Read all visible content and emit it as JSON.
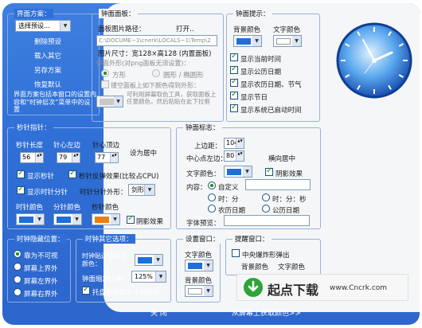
{
  "colors": {
    "app_blue": "#2f6fd6",
    "panel_bg": "#f5f6f8",
    "swatch_blue": "#1e6fd8",
    "swatch_orange": "#f07d10",
    "swatch_gray": "#c8c8c8"
  },
  "left": {
    "scheme_title": "界面方案：",
    "scheme_select": "选择预设...",
    "delete_preset": "删除预设",
    "load_other": "载入其它",
    "save_as": "另存方案",
    "restore_default": "恢复默认",
    "scheme_note": "界面方案包括本窗口的设置内容和“时钟层次”菜单中的设置",
    "second_hand_title": "秒针指针：",
    "hidden_position_title": "时钟隐藏位置：",
    "hidden_options": [
      "靠为不可视",
      "屏幕上界外",
      "屏幕左界外",
      "屏幕右界外"
    ]
  },
  "clock_panel": {
    "title": "钟面面板：",
    "image_path_label": "面板图片路径：",
    "open_label": "打开..",
    "path_value": "C:\\DOCUME~1\\cnerk\\LOCALS~1\\Temp\\2",
    "image_size": "图片尺寸：宽128×高128 (内置面板)",
    "shape_label": "钟面外形(对png面板无须设置)：",
    "shape_square": "方形",
    "shape_round": "圆形 / 椭圆形",
    "dropper_label": "镂空面板上如下颜色得到外形：",
    "dropper_note": "可利用屏幕取色工具，获取面板上任意颜色，然后粘贴在此下拉框"
  },
  "clock_hint": {
    "title": "钟面提示：",
    "bg_color_label": "背景颜色",
    "text_color_label": "文字颜色",
    "options": [
      "显示当前时间",
      "显示公历日期",
      "显示农历日期、节气",
      "显示节日",
      "显示系统已启动时间"
    ]
  },
  "hands": {
    "length_label": "秒针长度",
    "left_label": "针心左边",
    "top_label": "针心顶边",
    "length_value": "56",
    "left_value": "79",
    "top_value": "77",
    "center_label": "设为居中",
    "show_second": "显示秒针",
    "second_reverse": "秒针反弹效果(比较占CPU)",
    "show_hour_minute": "显示时针分针",
    "hm_shape_label": "时针分针外形：",
    "hm_shape_value": "剑形",
    "hour_color": "时针颜色",
    "minute_color": "分针颜色",
    "second_color": "秒针颜色",
    "shadow": "阴影效果"
  },
  "face_mark": {
    "title": "钟面标志：",
    "top_label": "上边距：",
    "top_value": "104",
    "center_left_label": "中心点左边：",
    "center_left_value": "80",
    "h_center": "横向居中",
    "text_color_label": "文字颜色：",
    "shadow": "阴影效果",
    "content_label": "内容：",
    "custom": "自定义",
    "opt_hm": "时：分",
    "opt_hms": "时：分：秒",
    "opt_lunar": "农历日期",
    "opt_solar": "公历日期",
    "font_preview": "字体预览："
  },
  "other_options": {
    "title": "时钟其它选项：",
    "auto_hide": "时钟贴边隐藏线颜色：",
    "zoom_label": "钟面缩放比率：",
    "zoom_value": "125%",
    "tray_tip": "托盘图标提示今日信息"
  },
  "settings_window": {
    "title": "设置窗口：",
    "text_color": "文字颜色",
    "bg_color": "背景颜色"
  },
  "reminder_window": {
    "title": "提醒窗口：",
    "center_popup": "中央爆炸形弹出",
    "bg_color": "背景颜色",
    "text_color": "文字颜色"
  },
  "footer": {
    "close": "关  闭",
    "pick_color": "从屏幕上获取颜色>>"
  },
  "watermark": {
    "brand": "起点下载",
    "url": "www.Cncrk.com"
  }
}
